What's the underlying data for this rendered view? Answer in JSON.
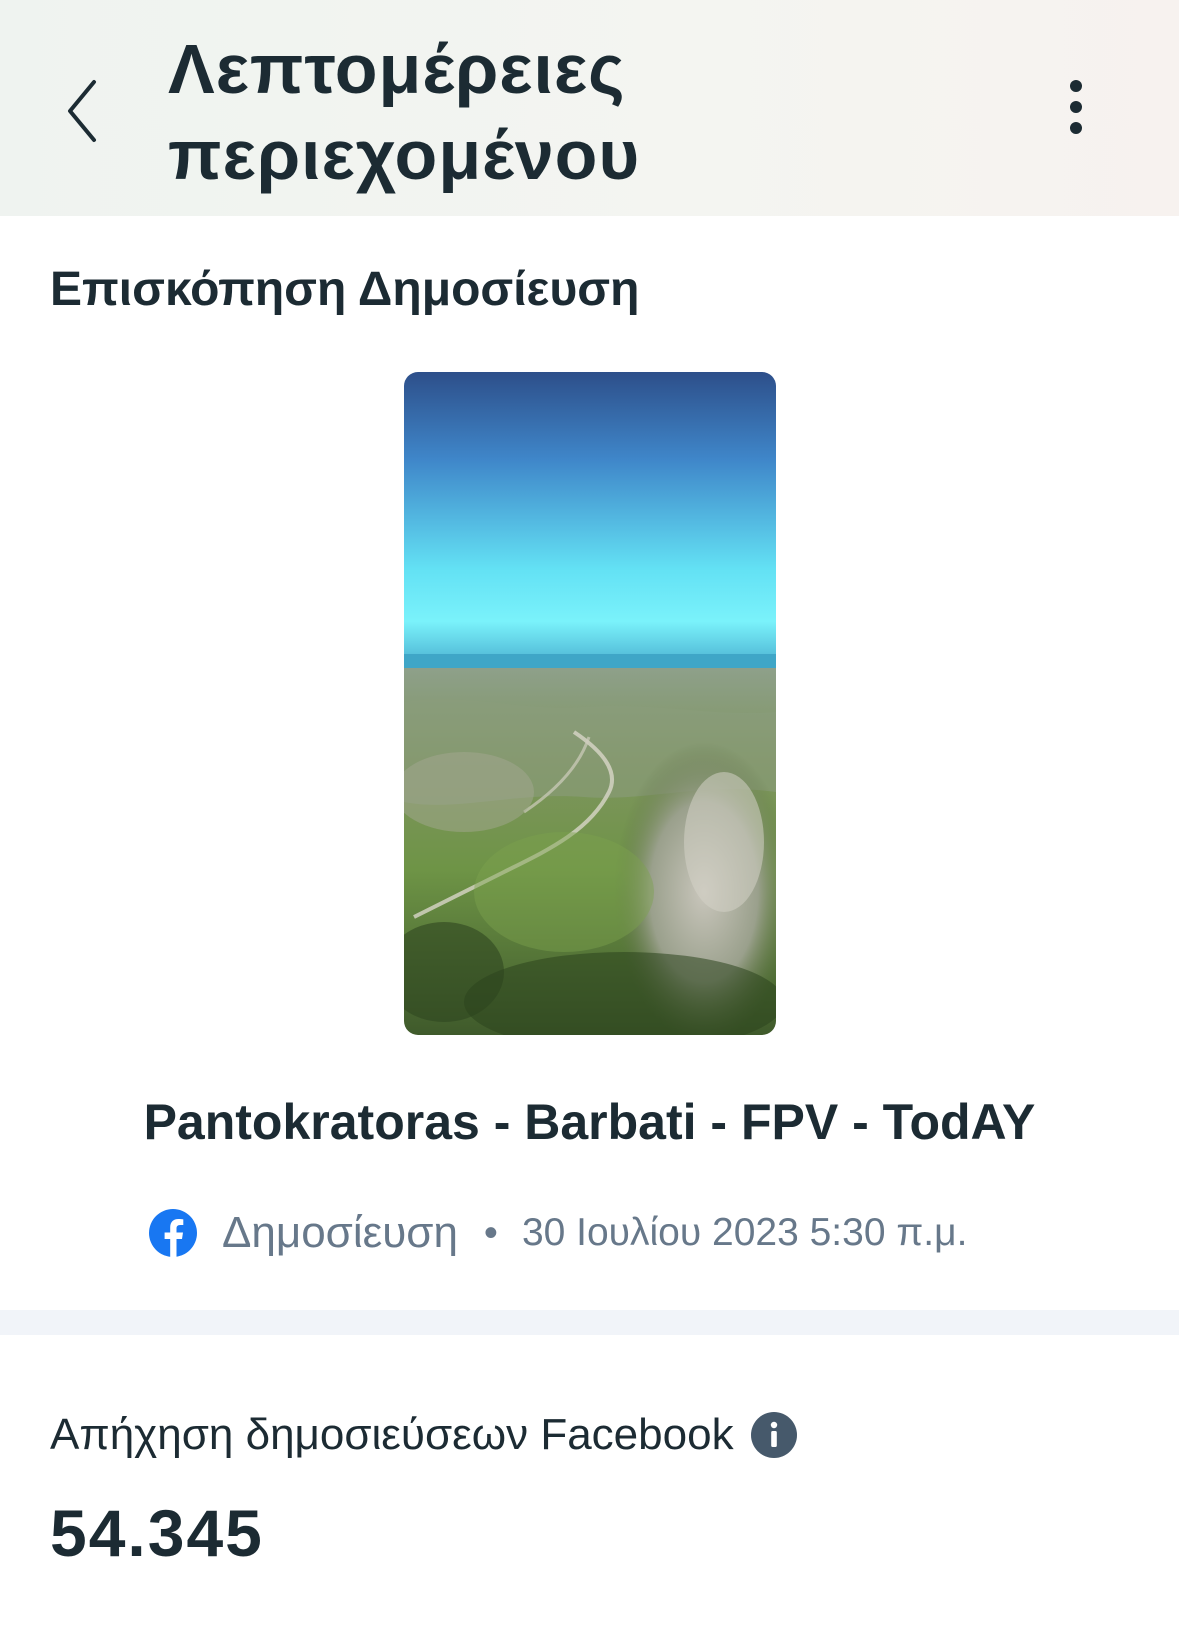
{
  "header": {
    "back_icon": "chevron-left-icon",
    "title_line1": "Λεπτομέρειες",
    "title_line2": "περιεχομένου",
    "menu_icon": "vertical-ellipsis-icon"
  },
  "preview": {
    "heading": "Επισκόπηση Δημοσίευση",
    "thumbnail": "aerial-landscape-thumbnail",
    "post_title": "Pantokratoras - Barbati - FPV - TodAY",
    "platform_icon": "facebook-icon",
    "post_type": "Δημοσίευση",
    "separator": "•",
    "date": "30 Ιουλίου 2023 5:30 π.μ."
  },
  "metric": {
    "label": "Απήχηση δημοσιεύσεων Facebook",
    "info_icon": "info-icon",
    "value": "54.345"
  },
  "colors": {
    "text_primary": "#1c2b33",
    "text_secondary": "#67788a",
    "facebook_blue": "#1877f2",
    "divider": "#f1f4f9"
  }
}
